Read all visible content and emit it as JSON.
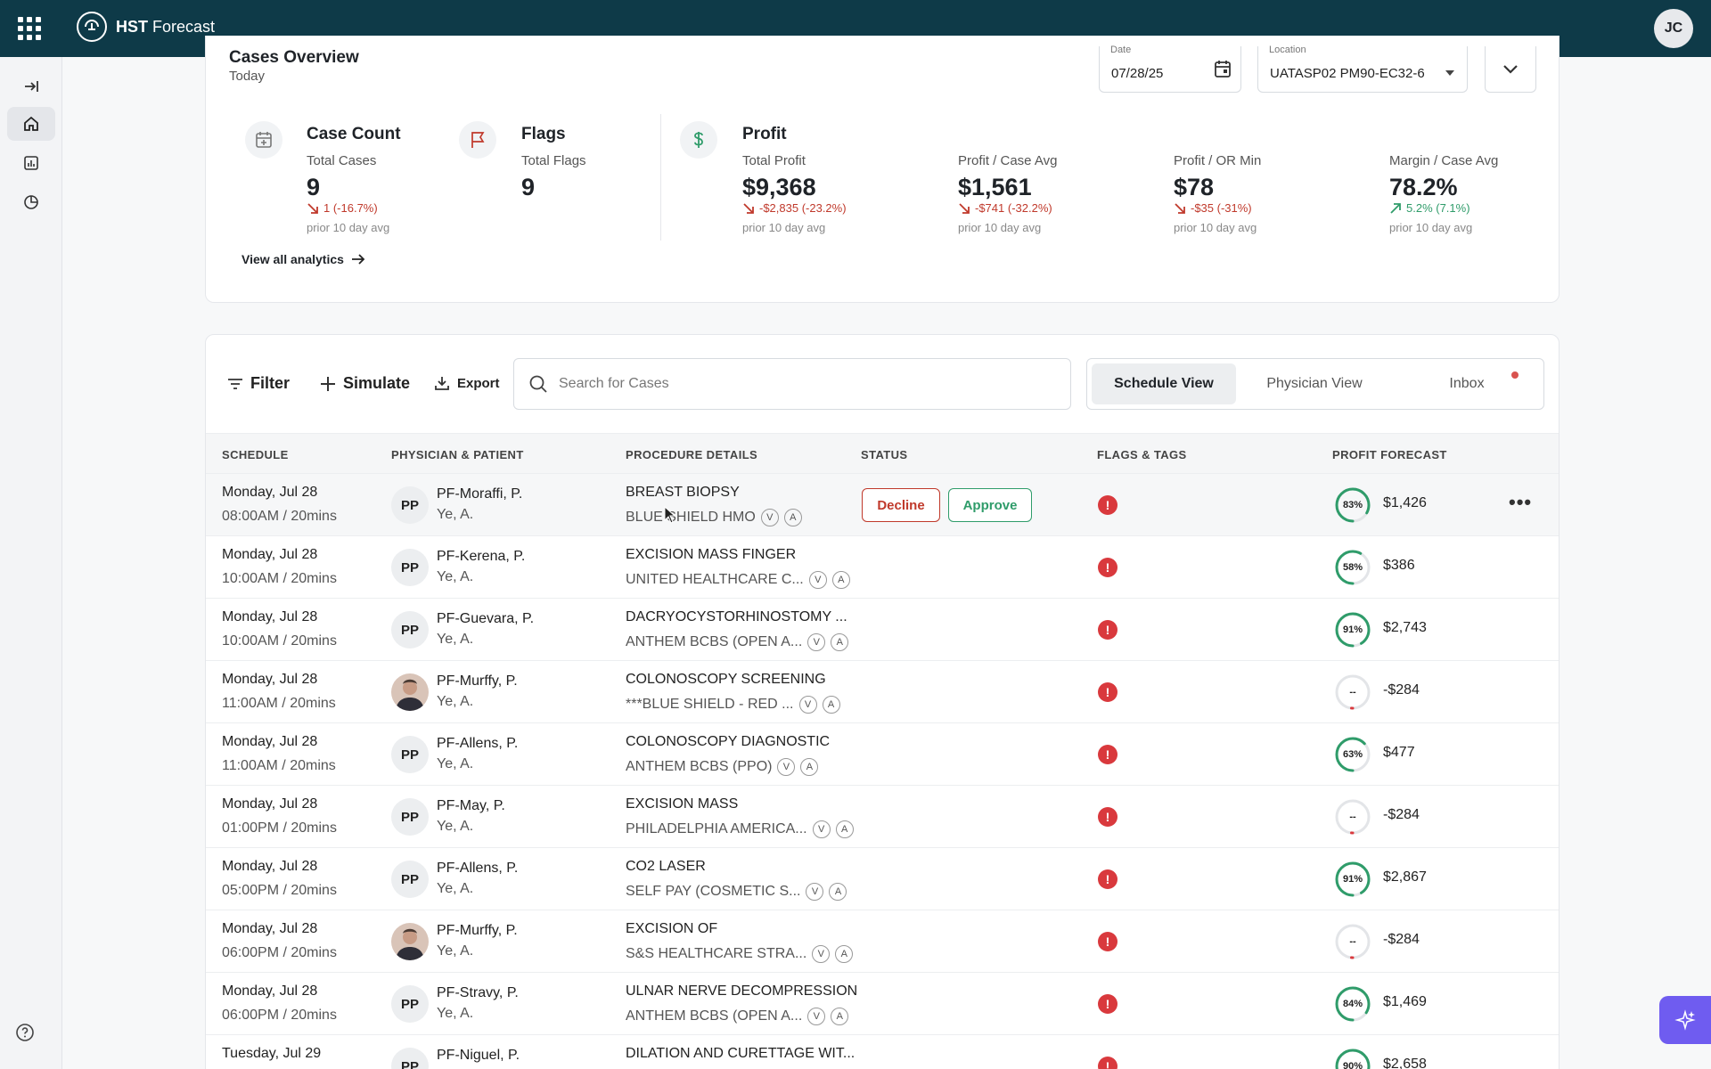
{
  "app": {
    "title_bold": "HST",
    "title_rest": " Forecast",
    "user_initials": "JC"
  },
  "overview": {
    "title": "Cases Overview",
    "subtitle": "Today",
    "date_label": "Date",
    "date_value": "07/28/25",
    "location_label": "Location",
    "location_value": "UATASP02 PM90-EC32-6",
    "case_count": {
      "title": "Case Count",
      "label": "Total Cases",
      "value": "9",
      "delta": "1 (-16.7%)",
      "prior": "prior 10 day avg"
    },
    "flags": {
      "title": "Flags",
      "label": "Total Flags",
      "value": "9"
    },
    "profit": {
      "title": "Profit",
      "total": {
        "label": "Total Profit",
        "value": "$9,368",
        "delta": "-$2,835 (-23.2%)",
        "prior": "prior 10 day avg"
      },
      "per_case": {
        "label": "Profit / Case Avg",
        "value": "$1,561",
        "delta": "-$741 (-32.2%)",
        "prior": "prior 10 day avg"
      },
      "per_or_min": {
        "label": "Profit / OR Min",
        "value": "$78",
        "delta": "-$35 (-31%)",
        "prior": "prior 10 day avg"
      },
      "margin": {
        "label": "Margin / Case Avg",
        "value": "78.2%",
        "delta": "5.2% (7.1%)",
        "prior": "prior 10 day avg"
      }
    },
    "view_all": "View all analytics"
  },
  "toolbar": {
    "filter": "Filter",
    "simulate": "Simulate",
    "export": "Export",
    "search_placeholder": "Search for Cases",
    "views": [
      "Schedule View",
      "Physician View",
      "Inbox"
    ]
  },
  "table": {
    "headers": [
      "SCHEDULE",
      "PHYSICIAN & PATIENT",
      "PROCEDURE DETAILS",
      "STATUS",
      "FLAGS & TAGS",
      "PROFIT FORECAST"
    ],
    "decline": "Decline",
    "approve": "Approve",
    "tag_v": "V",
    "tag_a": "A",
    "flag_glyph": "!",
    "more_glyph": "•••",
    "rows": [
      {
        "day": "Monday, Jul 28",
        "time": "08:00AM / 20mins",
        "initials": "PP",
        "photo": false,
        "physician": "PF-Moraffi, P.",
        "patient": "Ye, A.",
        "procedure": "BREAST BIOPSY",
        "insurance": "BLUE SHIELD HMO",
        "gauge": "83%",
        "pct": 0.83,
        "profit": "$1,426"
      },
      {
        "day": "Monday, Jul 28",
        "time": "10:00AM / 20mins",
        "initials": "PP",
        "photo": false,
        "physician": "PF-Kerena, P.",
        "patient": "Ye, A.",
        "procedure": "EXCISION MASS FINGER",
        "insurance": "UNITED HEALTHCARE C...",
        "gauge": "58%",
        "pct": 0.58,
        "profit": "$386"
      },
      {
        "day": "Monday, Jul 28",
        "time": "10:00AM / 20mins",
        "initials": "PP",
        "photo": false,
        "physician": "PF-Guevara, P.",
        "patient": "Ye, A.",
        "procedure": "DACRYOCYSTORHINOSTOMY ...",
        "insurance": "ANTHEM BCBS (OPEN A...",
        "gauge": "91%",
        "pct": 0.91,
        "profit": "$2,743"
      },
      {
        "day": "Monday, Jul 28",
        "time": "11:00AM / 20mins",
        "initials": "",
        "photo": true,
        "physician": "PF-Murffy, P.",
        "patient": "Ye, A.",
        "procedure": "COLONOSCOPY SCREENING",
        "insurance": "***BLUE SHIELD - RED ...",
        "gauge": "--",
        "pct": 0,
        "profit": "-$284"
      },
      {
        "day": "Monday, Jul 28",
        "time": "11:00AM / 20mins",
        "initials": "PP",
        "photo": false,
        "physician": "PF-Allens, P.",
        "patient": "Ye, A.",
        "procedure": "COLONOSCOPY DIAGNOSTIC",
        "insurance": "ANTHEM BCBS (PPO)",
        "gauge": "63%",
        "pct": 0.63,
        "profit": "$477"
      },
      {
        "day": "Monday, Jul 28",
        "time": "01:00PM / 20mins",
        "initials": "PP",
        "photo": false,
        "physician": "PF-May, P.",
        "patient": "Ye, A.",
        "procedure": "EXCISION MASS",
        "insurance": "PHILADELPHIA AMERICA...",
        "gauge": "--",
        "pct": 0,
        "profit": "-$284"
      },
      {
        "day": "Monday, Jul 28",
        "time": "05:00PM / 20mins",
        "initials": "PP",
        "photo": false,
        "physician": "PF-Allens, P.",
        "patient": "Ye, A.",
        "procedure": "CO2 LASER",
        "insurance": "SELF PAY (COSMETIC S...",
        "gauge": "91%",
        "pct": 0.91,
        "profit": "$2,867"
      },
      {
        "day": "Monday, Jul 28",
        "time": "06:00PM / 20mins",
        "initials": "",
        "photo": true,
        "physician": "PF-Murffy, P.",
        "patient": "Ye, A.",
        "procedure": "EXCISION OF",
        "insurance": "S&S HEALTHCARE STRA...",
        "gauge": "--",
        "pct": 0,
        "profit": "-$284"
      },
      {
        "day": "Monday, Jul 28",
        "time": "06:00PM / 20mins",
        "initials": "PP",
        "photo": false,
        "physician": "PF-Stravy, P.",
        "patient": "Ye, A.",
        "procedure": "ULNAR NERVE DECOMPRESSION",
        "insurance": "ANTHEM BCBS (OPEN A...",
        "gauge": "84%",
        "pct": 0.84,
        "profit": "$1,469"
      },
      {
        "day": "Tuesday, Jul 29",
        "time": "",
        "initials": "PP",
        "photo": false,
        "physician": "PF-Niguel, P.",
        "patient": "",
        "procedure": "DILATION AND CURETTAGE WIT...",
        "insurance": "",
        "gauge": "90%",
        "pct": 0.9,
        "profit": "$2,658"
      }
    ]
  },
  "colors": {
    "topbar": "#0e3a48",
    "positive": "#2f9c6a",
    "negative": "#c0392b",
    "flag": "#d9393d",
    "ai_button": "#6f5cf0"
  }
}
